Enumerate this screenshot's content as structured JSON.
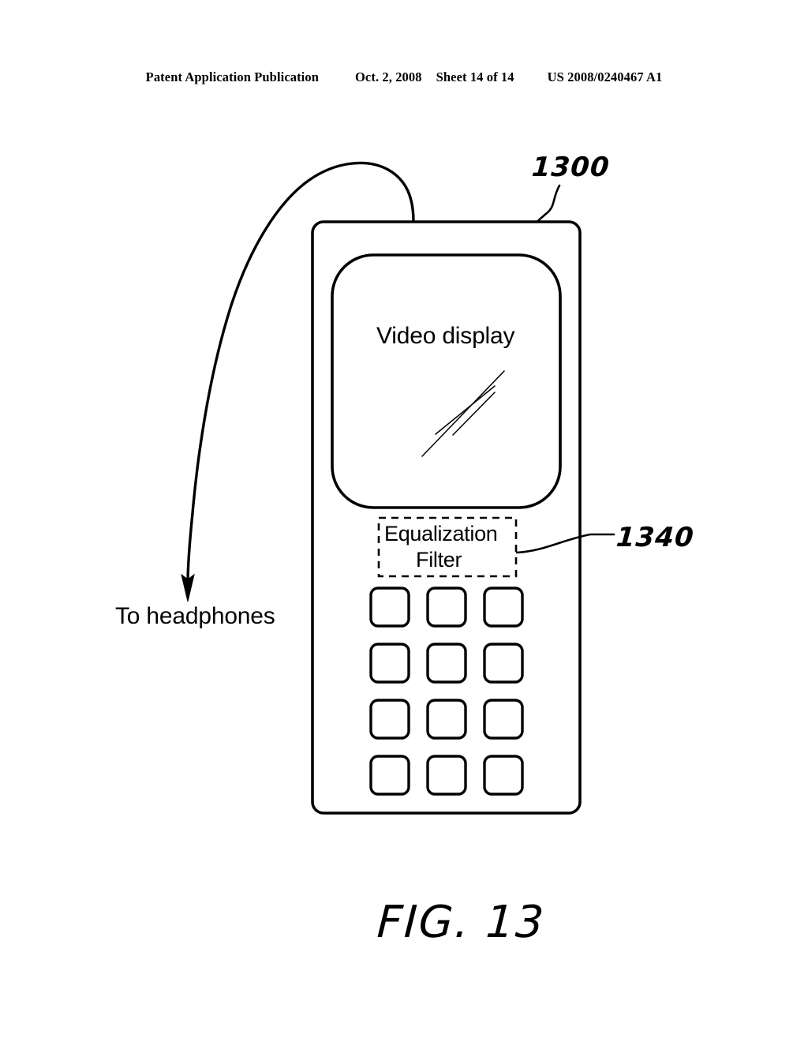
{
  "page_header": {
    "publication": "Patent Application Publication",
    "date": "Oct. 2, 2008",
    "sheet": "Sheet 14 of 14",
    "patent_number": "US 2008/0240467 A1"
  },
  "figure": {
    "caption": "FIG. 13",
    "device_label": "1300",
    "filter_label": "1340",
    "screen_text": "Video display",
    "filter_text_line1": "Equalization",
    "filter_text_line2": "Filter",
    "cable_text": "To headphones",
    "ink_color": "#000000",
    "background_color": "#ffffff"
  },
  "keypad": {
    "rows": 4,
    "columns": 3,
    "keys": [
      "",
      "",
      "",
      "",
      "",
      "",
      "",
      "",
      "",
      "",
      "",
      ""
    ]
  }
}
